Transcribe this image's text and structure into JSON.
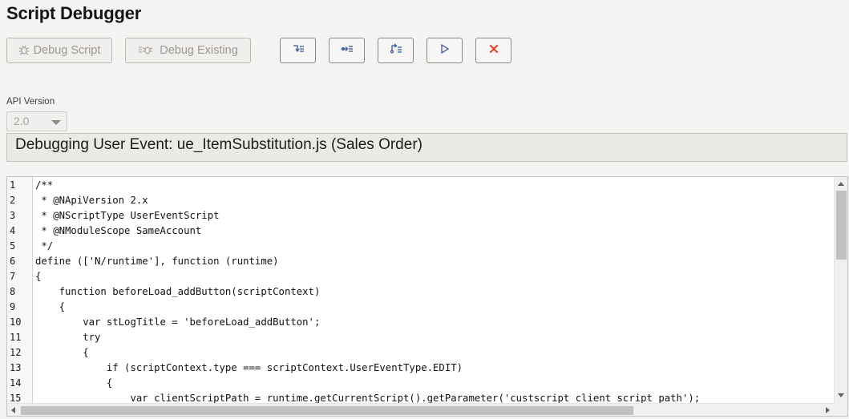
{
  "page": {
    "title": "Script Debugger"
  },
  "toolbar": {
    "debug_script_label": "Debug Script",
    "debug_existing_label": "Debug Existing",
    "icon_buttons": [
      {
        "name": "step-over-icon"
      },
      {
        "name": "step-into-icon"
      },
      {
        "name": "step-out-icon"
      },
      {
        "name": "continue-icon"
      },
      {
        "name": "stop-icon"
      }
    ]
  },
  "api": {
    "label": "API Version",
    "selected": "2.0"
  },
  "status": {
    "text": "Debugging User Event: ue_ItemSubstitution.js (Sales Order)"
  },
  "editor": {
    "lines": [
      {
        "n": "1",
        "code": "/**"
      },
      {
        "n": "2",
        "code": " * @NApiVersion 2.x"
      },
      {
        "n": "3",
        "code": " * @NScriptType UserEventScript"
      },
      {
        "n": "4",
        "code": " * @NModuleScope SameAccount"
      },
      {
        "n": "5",
        "code": " */"
      },
      {
        "n": "6",
        "code": "define (['N/runtime'], function (runtime)"
      },
      {
        "n": "7",
        "code": "{"
      },
      {
        "n": "8",
        "code": "    function beforeLoad_addButton(scriptContext)"
      },
      {
        "n": "9",
        "code": "    {"
      },
      {
        "n": "10",
        "code": "        var stLogTitle = 'beforeLoad_addButton';"
      },
      {
        "n": "11",
        "code": "        try"
      },
      {
        "n": "12",
        "code": "        {"
      },
      {
        "n": "13",
        "code": "            if (scriptContext.type === scriptContext.UserEventType.EDIT)"
      },
      {
        "n": "14",
        "code": "            {"
      },
      {
        "n": "15",
        "code": "                var clientScriptPath = runtime.getCurrentScript().getParameter('custscript_client_script_path');"
      }
    ]
  },
  "colors": {
    "stop_icon": "#d9472b",
    "toolbar_icon": "#3a5a9c",
    "disabled_text": "#9c9893"
  }
}
